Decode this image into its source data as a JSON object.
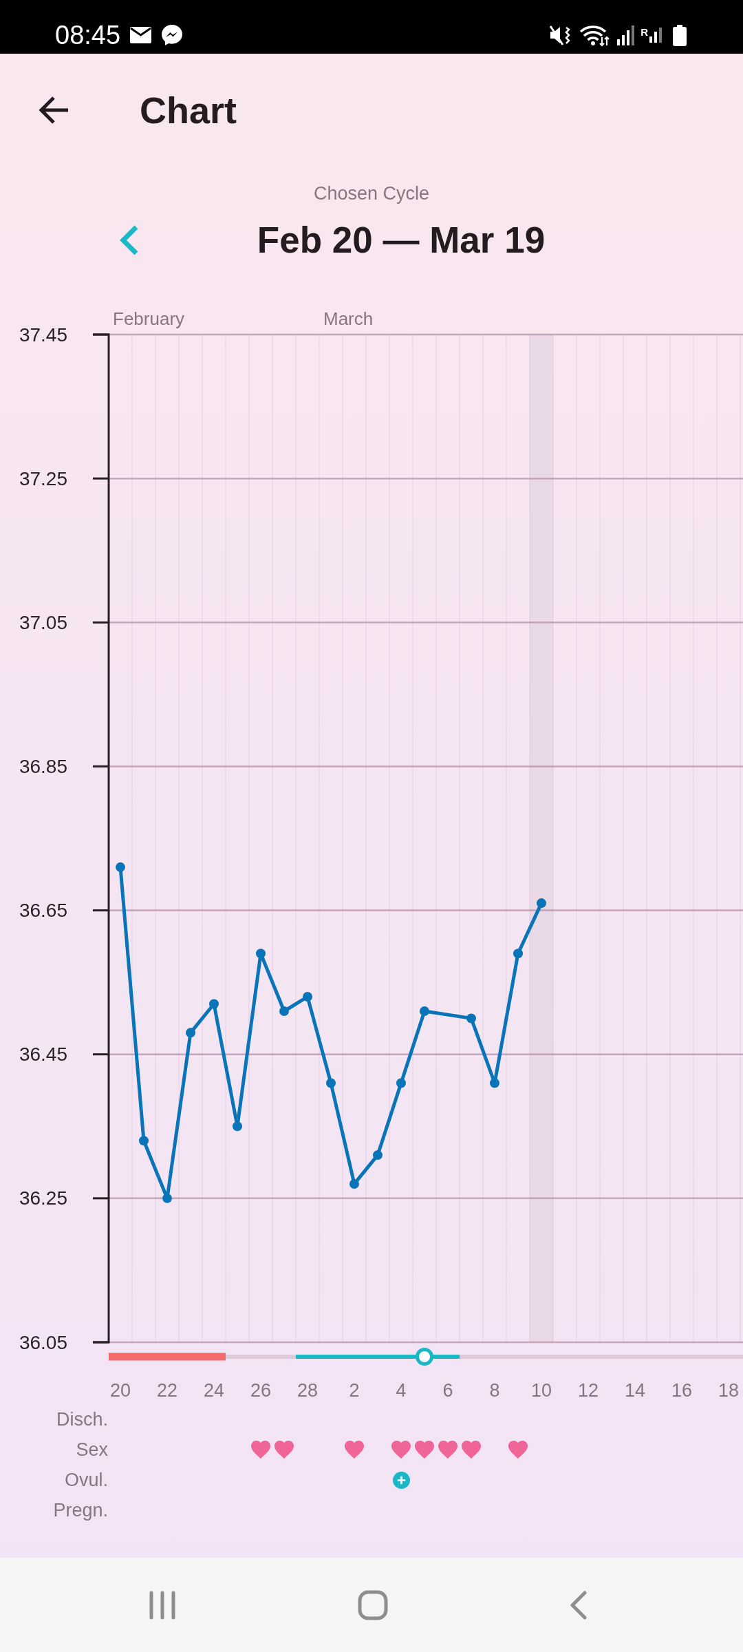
{
  "status_bar": {
    "time": "08:45",
    "network_badge": "R"
  },
  "app_bar": {
    "title": "Chart"
  },
  "cycle_picker": {
    "caption": "Chosen Cycle",
    "range": "Feb 20 — Mar 19"
  },
  "chart": {
    "chart_data": {
      "type": "line",
      "categories": [
        "20",
        null,
        "22",
        null,
        "24",
        null,
        "26",
        null,
        "28",
        null,
        "2",
        null,
        "4",
        null,
        "6",
        null,
        "8",
        null,
        "10",
        null,
        "12",
        null,
        "14",
        null,
        "16",
        null,
        "18"
      ],
      "series": [
        {
          "color": "#0a74b8",
          "marker": "circle",
          "values": [
            36.71,
            36.33,
            36.25,
            36.48,
            36.52,
            36.35,
            36.59,
            36.51,
            36.53,
            36.41,
            36.27,
            36.31,
            36.41,
            36.51,
            null,
            36.5,
            36.41,
            36.59,
            36.66,
            null,
            null,
            null,
            null,
            null,
            null,
            null,
            null
          ]
        }
      ],
      "ylim": [
        36.05,
        37.45
      ],
      "yticks": [
        36.05,
        36.25,
        36.45,
        36.65,
        36.85,
        37.05,
        37.25,
        37.45
      ],
      "grid": true,
      "bands": [
        {
          "axis": "x",
          "from": "10",
          "to": "10",
          "color": "#e9d8e6"
        }
      ]
    },
    "days": [
      {
        "kind": "period",
        "month": "February"
      },
      {
        "kind": "period"
      },
      {
        "kind": "period"
      },
      {
        "kind": "period"
      },
      {
        "kind": "period"
      },
      {
        "kind": "plain"
      },
      {
        "kind": "plain"
      },
      {
        "kind": "plain"
      },
      {
        "kind": "fertile"
      },
      {
        "kind": "fertile",
        "month": "March"
      },
      {
        "kind": "fertile"
      },
      {
        "kind": "fertile"
      },
      {
        "kind": "fertile"
      },
      {
        "kind": "ovulation"
      },
      {
        "kind": "fertile"
      },
      {
        "kind": "plain"
      },
      {
        "kind": "plain"
      },
      {
        "kind": "plain"
      },
      {
        "kind": "plain"
      },
      {
        "kind": "plain"
      },
      {
        "kind": "plain"
      },
      {
        "kind": "plain"
      },
      {
        "kind": "plain"
      },
      {
        "kind": "plain"
      },
      {
        "kind": "plain"
      },
      {
        "kind": "plain"
      },
      {
        "kind": "plain"
      }
    ]
  },
  "tracker_rows": [
    {
      "label": "Disch."
    },
    {
      "label": "Sex",
      "cells": [
        {
          "kind": "none"
        },
        {
          "kind": "none"
        },
        {
          "kind": "none"
        },
        {
          "kind": "none"
        },
        {
          "kind": "none"
        },
        {
          "kind": "none"
        },
        {
          "kind": "heart"
        },
        {
          "kind": "heart"
        },
        {
          "kind": "none"
        },
        {
          "kind": "none"
        },
        {
          "kind": "heart"
        },
        {
          "kind": "none"
        },
        {
          "kind": "heart"
        },
        {
          "kind": "heart"
        },
        {
          "kind": "heart"
        },
        {
          "kind": "heart"
        },
        {
          "kind": "none"
        },
        {
          "kind": "heart"
        },
        {
          "kind": "none"
        },
        {
          "kind": "none"
        },
        {
          "kind": "none"
        },
        {
          "kind": "none"
        },
        {
          "kind": "none"
        },
        {
          "kind": "none"
        },
        {
          "kind": "none"
        },
        {
          "kind": "none"
        },
        {
          "kind": "none"
        }
      ]
    },
    {
      "label": "Ovul.",
      "cells": [
        {
          "kind": "none"
        },
        {
          "kind": "none"
        },
        {
          "kind": "none"
        },
        {
          "kind": "none"
        },
        {
          "kind": "none"
        },
        {
          "kind": "none"
        },
        {
          "kind": "none"
        },
        {
          "kind": "none"
        },
        {
          "kind": "none"
        },
        {
          "kind": "none"
        },
        {
          "kind": "none"
        },
        {
          "kind": "none"
        },
        {
          "kind": "plus"
        },
        {
          "kind": "none"
        },
        {
          "kind": "none"
        },
        {
          "kind": "none"
        },
        {
          "kind": "none"
        },
        {
          "kind": "none"
        },
        {
          "kind": "none"
        },
        {
          "kind": "none"
        },
        {
          "kind": "none"
        },
        {
          "kind": "none"
        },
        {
          "kind": "none"
        },
        {
          "kind": "none"
        },
        {
          "kind": "none"
        },
        {
          "kind": "none"
        },
        {
          "kind": "none"
        }
      ]
    },
    {
      "label": "Pregn."
    }
  ]
}
